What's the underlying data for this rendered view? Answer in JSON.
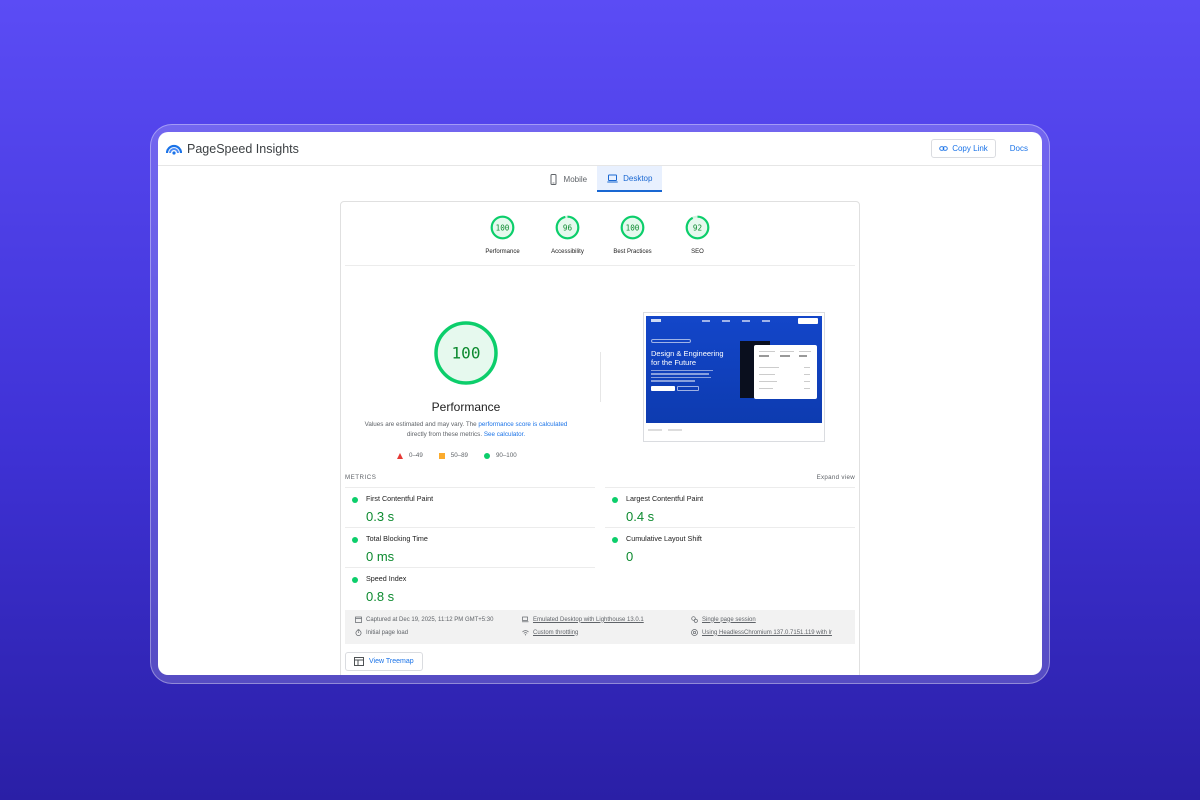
{
  "app": {
    "title": "PageSpeed Insights"
  },
  "topbar": {
    "copy_link": "Copy Link",
    "docs": "Docs"
  },
  "tabs": [
    {
      "label": "Mobile",
      "active": false
    },
    {
      "label": "Desktop",
      "active": true
    }
  ],
  "scores": [
    {
      "label": "Performance",
      "value": 100
    },
    {
      "label": "Accessibility",
      "value": 96
    },
    {
      "label": "Best Practices",
      "value": 100
    },
    {
      "label": "SEO",
      "value": 92
    }
  ],
  "performance": {
    "score": 100,
    "title": "Performance",
    "note_prefix": "Values are estimated and may vary. The ",
    "note_link1": "performance score is calculated",
    "note_middle": " directly from these metrics. ",
    "note_link2": "See calculator."
  },
  "legend": [
    {
      "range": "0–49",
      "color": "#e53935"
    },
    {
      "range": "50–89",
      "color": "#fbab2d"
    },
    {
      "range": "90–100",
      "color": "#0cce6b"
    }
  ],
  "screenshot": {
    "headline_1": "Design & Engineering",
    "headline_2": "for the Future"
  },
  "metrics": {
    "heading": "METRICS",
    "expand": "Expand view",
    "left": [
      {
        "name": "First Contentful Paint",
        "value": "0.3 s"
      },
      {
        "name": "Total Blocking Time",
        "value": "0 ms"
      },
      {
        "name": "Speed Index",
        "value": "0.8 s"
      }
    ],
    "right": [
      {
        "name": "Largest Contentful Paint",
        "value": "0.4 s"
      },
      {
        "name": "Cumulative Layout Shift",
        "value": "0"
      }
    ]
  },
  "info": {
    "captured": "Captured at Dec 19, 2025, 11:12 PM GMT+5:30",
    "load": "Initial page load",
    "emulated": "Emulated Desktop with Lighthouse 13.0.1",
    "throttling": "Custom throttling",
    "session": "Single page session",
    "browser": "Using HeadlessChromium 137.0.7151.119 with lr"
  },
  "treemap": {
    "label": "View Treemap"
  },
  "colors": {
    "good": "#0cce6b",
    "good_text": "#0c8a2f",
    "accent": "#1a73e8"
  }
}
